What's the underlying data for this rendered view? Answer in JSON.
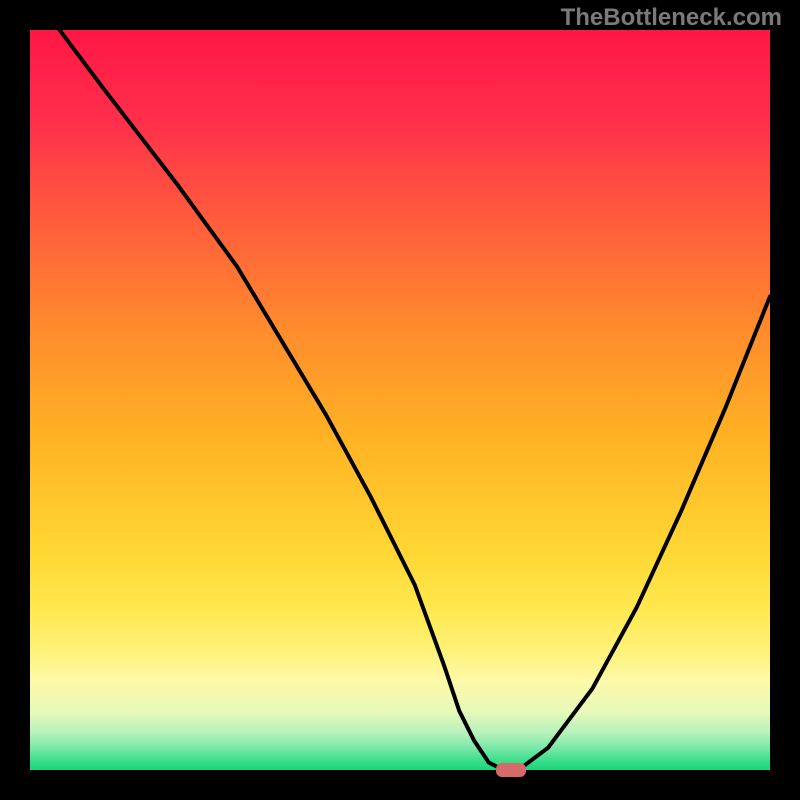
{
  "watermark": "TheBottleneck.com",
  "chart_data": {
    "type": "line",
    "title": "",
    "xlabel": "",
    "ylabel": "",
    "xlim": [
      0,
      100
    ],
    "ylim": [
      0,
      100
    ],
    "series": [
      {
        "name": "curve",
        "x": [
          4,
          10,
          20,
          28,
          34,
          40,
          46,
          52,
          56,
          58,
          60,
          62,
          64,
          66,
          70,
          76,
          82,
          88,
          94,
          100
        ],
        "y": [
          100,
          92,
          79,
          68,
          58,
          48,
          37,
          25,
          14,
          8,
          4,
          1,
          0,
          0,
          3,
          11,
          22,
          35,
          49,
          64
        ]
      }
    ],
    "marker": {
      "x": 65,
      "y": 0
    },
    "gradient_stops": [
      {
        "offset": 0,
        "color": "#ff1744"
      },
      {
        "offset": 12,
        "color": "#ff2e4c"
      },
      {
        "offset": 25,
        "color": "#ff5a3d"
      },
      {
        "offset": 40,
        "color": "#ff8a2d"
      },
      {
        "offset": 55,
        "color": "#ffb224"
      },
      {
        "offset": 70,
        "color": "#ffd633"
      },
      {
        "offset": 78,
        "color": "#ffe74d"
      },
      {
        "offset": 84,
        "color": "#fff27a"
      },
      {
        "offset": 88,
        "color": "#fdf9a8"
      },
      {
        "offset": 92,
        "color": "#e8f9b8"
      },
      {
        "offset": 95,
        "color": "#b6f2bc"
      },
      {
        "offset": 97,
        "color": "#7ae8a8"
      },
      {
        "offset": 99,
        "color": "#33dd88"
      },
      {
        "offset": 100,
        "color": "#1ad67a"
      }
    ],
    "frame": {
      "outer": 800,
      "border": 30
    }
  }
}
